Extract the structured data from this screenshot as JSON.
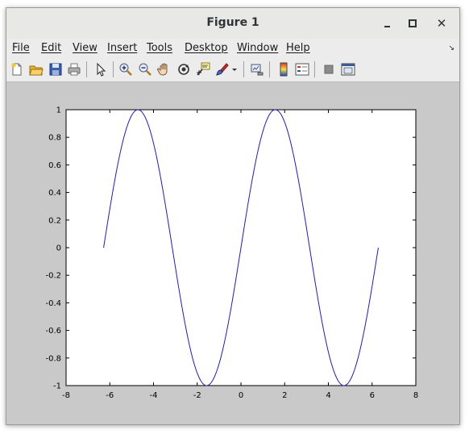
{
  "window": {
    "title": "Figure 1",
    "controls": {
      "minimize": "minimize",
      "maximize": "maximize",
      "close": "close"
    }
  },
  "menubar": {
    "items": [
      {
        "label": "File"
      },
      {
        "label": "Edit"
      },
      {
        "label": "View"
      },
      {
        "label": "Insert"
      },
      {
        "label": "Tools"
      },
      {
        "label": "Desktop"
      },
      {
        "label": "Window"
      },
      {
        "label": "Help"
      }
    ],
    "dock_arrow": "↘"
  },
  "toolbar": {
    "buttons": [
      "new-figure-icon",
      "open-file-icon",
      "save-icon",
      "print-icon",
      "edit-plot-arrow-icon",
      "zoom-in-icon",
      "zoom-out-icon",
      "pan-hand-icon",
      "rotate-3d-icon",
      "data-cursor-icon",
      "brush-icon",
      "brush-dropdown-icon",
      "link-plot-icon",
      "colorbar-icon",
      "legend-icon",
      "hide-plot-tools-icon",
      "show-plot-tools-icon"
    ]
  },
  "chart_data": {
    "type": "line",
    "title": "",
    "xlabel": "",
    "ylabel": "",
    "xlim": [
      -8,
      8
    ],
    "ylim": [
      -1,
      1
    ],
    "xticks": [
      -8,
      -6,
      -4,
      -2,
      0,
      2,
      4,
      6,
      8
    ],
    "yticks": [
      -1,
      -0.8,
      -0.6,
      -0.4,
      -0.2,
      0,
      0.2,
      0.4,
      0.6,
      0.8,
      1
    ],
    "xtick_labels": [
      "-8",
      "-6",
      "-4",
      "-2",
      "0",
      "2",
      "4",
      "6",
      "8"
    ],
    "ytick_labels": [
      "-1",
      "-0.8",
      "-0.6",
      "-0.4",
      "-0.2",
      "0",
      "0.2",
      "0.4",
      "0.6",
      "0.8",
      "1"
    ],
    "grid": false,
    "series": [
      {
        "color": "#1f1fa8",
        "function": "sin(x)",
        "x_range": [
          -6.2832,
          6.2832
        ],
        "x": [
          -6.2832,
          -5.4978,
          -4.7124,
          -3.927,
          -3.1416,
          -2.3562,
          -1.5708,
          -0.7854,
          0,
          0.7854,
          1.5708,
          2.3562,
          3.1416,
          3.927,
          4.7124,
          5.4978,
          6.2832
        ],
        "y": [
          0,
          0.7071,
          1,
          0.7071,
          0,
          -0.7071,
          -1,
          -0.7071,
          0,
          0.7071,
          1,
          0.7071,
          0,
          -0.7071,
          -1,
          -0.7071,
          0
        ]
      }
    ]
  }
}
